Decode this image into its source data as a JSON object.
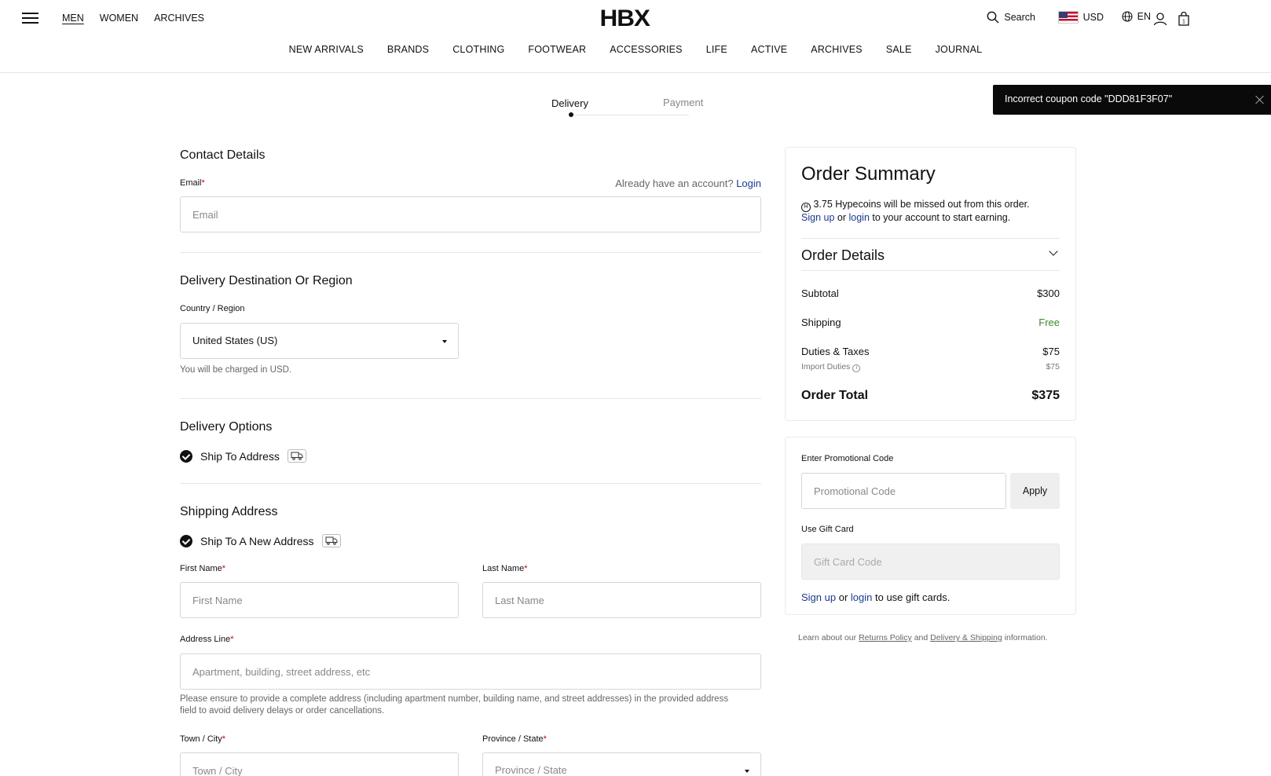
{
  "header": {
    "gender_nav": [
      "MEN",
      "WOMEN",
      "ARCHIVES"
    ],
    "logo": "HBX",
    "search_label": "Search",
    "currency": "USD",
    "language": "EN",
    "main_nav": [
      "NEW ARRIVALS",
      "BRANDS",
      "CLOTHING",
      "FOOTWEAR",
      "ACCESSORIES",
      "LIFE",
      "ACTIVE",
      "ARCHIVES",
      "SALE",
      "JOURNAL"
    ]
  },
  "steps": {
    "delivery": "Delivery",
    "payment": "Payment"
  },
  "toast": {
    "message": "Incorrect coupon code \"DDD81F3F07\""
  },
  "contact": {
    "title": "Contact Details",
    "email_label": "Email",
    "email_placeholder": "Email",
    "account_prompt": "Already have an account?",
    "login_link": "Login"
  },
  "destination": {
    "title": "Delivery Destination Or Region",
    "country_label": "Country / Region",
    "country_value": "United States (US)",
    "currency_note": "You will be charged in USD."
  },
  "delivery_options": {
    "title": "Delivery Options",
    "ship_to_address": "Ship To Address"
  },
  "shipping": {
    "title": "Shipping Address",
    "new_address": "Ship To A New Address",
    "first_name_label": "First Name",
    "first_name_placeholder": "First Name",
    "last_name_label": "Last Name",
    "last_name_placeholder": "Last Name",
    "address_label": "Address Line",
    "address_placeholder": "Apartment, building, street address, etc",
    "address_note_1": "Please ensure to provide a complete address (including apartment number, building name, and street addresses) in the provided address",
    "address_note_2": "field to avoid delivery delays or order cancellations.",
    "town_label": "Town / City",
    "town_placeholder": "Town / City",
    "province_label": "Province / State",
    "province_placeholder": "Province / State"
  },
  "summary": {
    "title": "Order Summary",
    "hype_text": "3.75 Hypecoins will be missed out from this order.",
    "sign_up": "Sign up",
    "or": "or",
    "login": "login",
    "earn_text": "to your account to start earning.",
    "order_details": "Order Details",
    "subtotal_label": "Subtotal",
    "subtotal_value": "$300",
    "shipping_label": "Shipping",
    "shipping_value": "Free",
    "duties_label": "Duties & Taxes",
    "duties_value": "$75",
    "import_label": "Import Duties",
    "import_value": "$75",
    "total_label": "Order Total",
    "total_value": "$375"
  },
  "promo": {
    "label": "Enter Promotional Code",
    "placeholder": "Promotional Code",
    "apply": "Apply",
    "gift_label": "Use Gift Card",
    "gift_placeholder": "Gift Card Code",
    "sign_up": "Sign up",
    "or": "or",
    "login": "login",
    "gift_note": "to use gift cards."
  },
  "legal": {
    "pre": "Learn about our",
    "returns": "Returns Policy",
    "and": "and",
    "delivery": "Delivery & Shipping",
    "post": "information."
  },
  "colors": {
    "accent_link": "#1a3a8f",
    "free": "#3a8a2a",
    "required": "#cc0000"
  }
}
